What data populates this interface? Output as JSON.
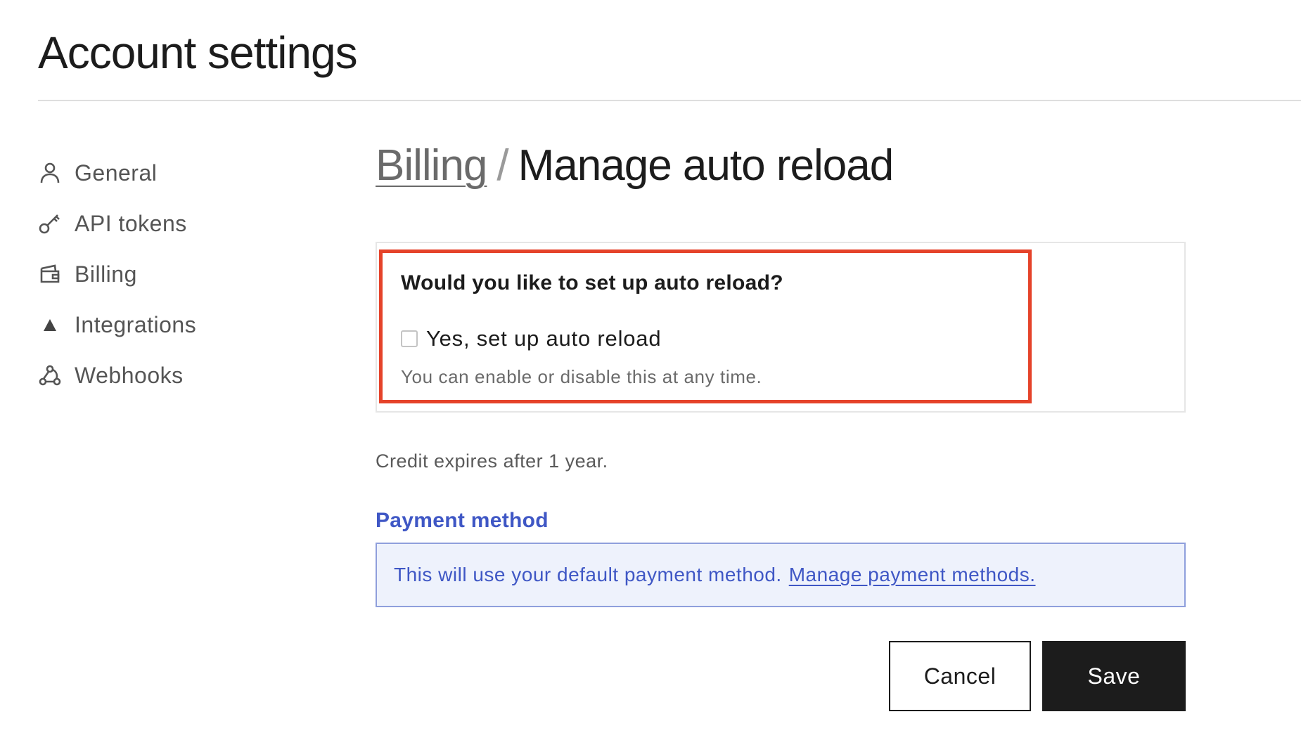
{
  "header": {
    "title": "Account settings"
  },
  "sidebar": {
    "items": [
      {
        "label": "General",
        "icon": "user-icon"
      },
      {
        "label": "API tokens",
        "icon": "key-icon"
      },
      {
        "label": "Billing",
        "icon": "wallet-icon"
      },
      {
        "label": "Integrations",
        "icon": "triangle-icon"
      },
      {
        "label": "Webhooks",
        "icon": "webhook-icon"
      }
    ]
  },
  "main": {
    "breadcrumb": {
      "parent": "Billing",
      "separator": "/",
      "current": "Manage auto reload"
    },
    "auto_reload": {
      "question": "Would you like to set up auto reload?",
      "checkbox_label": "Yes, set up auto reload",
      "checked": false,
      "helper": "You can enable or disable this at any time."
    },
    "credit_note": "Credit expires after 1 year.",
    "payment": {
      "heading": "Payment method",
      "info": "This will use your default payment method.",
      "link": "Manage payment methods."
    },
    "actions": {
      "cancel": "Cancel",
      "save": "Save"
    }
  },
  "colors": {
    "highlight": "#e5432a",
    "link_blue": "#3f57c5",
    "info_bg": "#eef2fc",
    "primary_button": "#1c1c1c"
  }
}
